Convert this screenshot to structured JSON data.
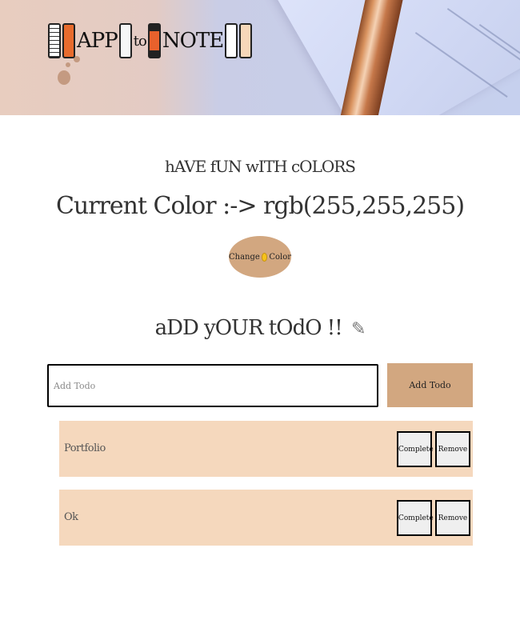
{
  "header": {
    "logo_parts": [
      "APP",
      "to",
      "NOTE"
    ],
    "banner_icon": "desk-pen-banner"
  },
  "colors": {
    "accent": "#d2a780",
    "todo_bg": "#f5d8bd",
    "page_bg": "#ffffff"
  },
  "color_section": {
    "subtitle": "hAVE fUN wITH cOLORS",
    "current_color": "Current Color :-> rgb(255,255,255)",
    "change_button_left": "Change",
    "change_button_icon": "smiley-icon",
    "change_button_right": "Color"
  },
  "todo_section": {
    "heading": "aDD yOUR tOdO !!",
    "heading_icon": "pencil-icon",
    "input_placeholder": "Add Todo",
    "input_value": "",
    "add_button": "Add Todo",
    "items": [
      {
        "text": "Portfolio",
        "complete_label": "Complete",
        "remove_label": "Remove"
      },
      {
        "text": "Ok",
        "complete_label": "Complete",
        "remove_label": "Remove"
      }
    ]
  }
}
